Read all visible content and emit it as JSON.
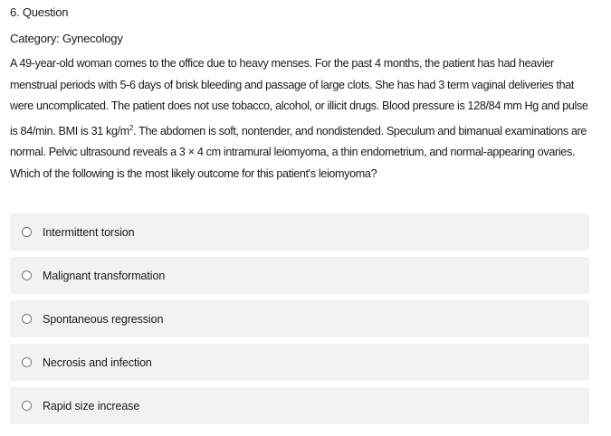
{
  "question": {
    "number_label": "6. Question",
    "category_label": "Category: Gynecology",
    "stem_part1": "A 49-year-old woman comes to the office due to heavy menses.  For the past 4 months, the patient has had heavier menstrual periods with 5-6 days of brisk bleeding and passage of large clots.  She has had 3 term vaginal deliveries that were uncomplicated.  The patient does not use tobacco, alcohol, or illicit drugs.  Blood pressure is 128/84 mm Hg and pulse is 84/min.  BMI is 31 kg/m",
    "stem_superscript": "2",
    "stem_part2": ".  The abdomen is soft, nontender, and nondistended.  Speculum and bimanual examinations are normal.  Pelvic ultrasound reveals a 3 × 4 cm intramural leiomyoma, a thin endometrium, and normal-appearing ovaries.  Which of the following is the most likely outcome for this patient's leiomyoma?"
  },
  "options": [
    {
      "label": "Intermittent torsion"
    },
    {
      "label": "Malignant transformation"
    },
    {
      "label": "Spontaneous regression"
    },
    {
      "label": "Necrosis and infection"
    },
    {
      "label": "Rapid size increase"
    }
  ],
  "colors": {
    "option_background": "#f1f2f2",
    "text": "#1a1a1a",
    "radio_border": "#777777"
  }
}
